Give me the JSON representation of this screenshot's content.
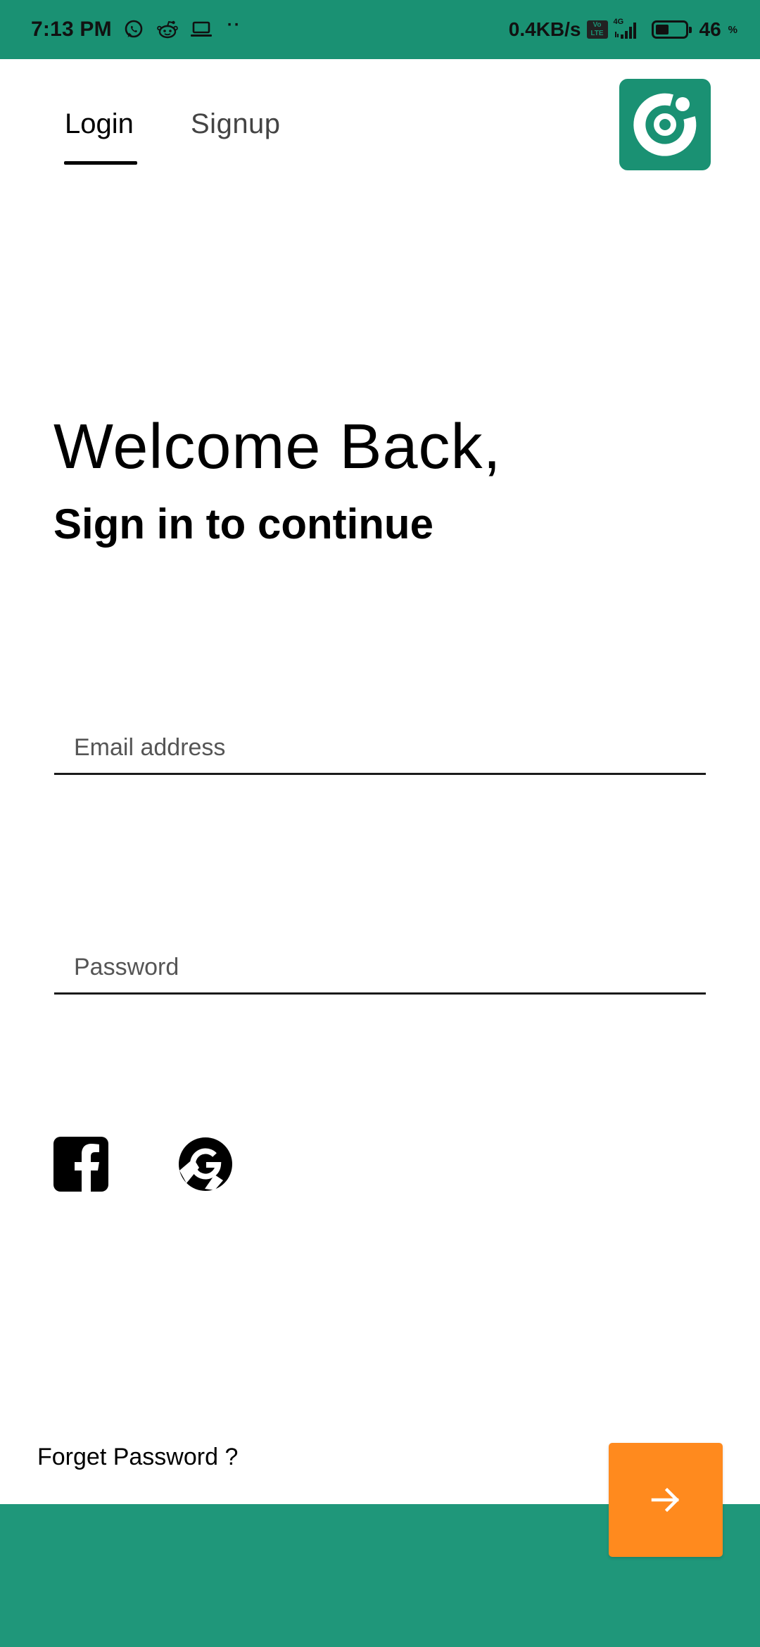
{
  "status_bar": {
    "time": "7:13 PM",
    "net_speed": "0.4KB/s",
    "volte_label": "Vo LTE",
    "network_type": "4G",
    "battery_level": "46",
    "battery_percent_sign": "%",
    "battery_fraction": 0.46,
    "overflow_dots": "··",
    "icons": [
      "whatsapp-icon",
      "reddit-icon",
      "laptop-icon",
      "volte-icon",
      "signal-icon",
      "battery-icon"
    ],
    "background_color": "#1a9173"
  },
  "tabs": [
    {
      "label": "Login",
      "active": true
    },
    {
      "label": "Signup",
      "active": false
    }
  ],
  "logo": {
    "icon": "app-logo-icon",
    "background_color": "#1a9173"
  },
  "heading": {
    "welcome": "Welcome Back,",
    "subtitle": "Sign in to continue"
  },
  "form": {
    "email": {
      "placeholder": "Email address",
      "value": ""
    },
    "password": {
      "placeholder": "Password",
      "value": ""
    }
  },
  "social": [
    {
      "icon": "facebook-icon"
    },
    {
      "icon": "google-icon"
    }
  ],
  "footer": {
    "forget_password": "Forget Password ?",
    "next_icon": "arrow-right-icon",
    "next_button_color": "#ff8a1e",
    "band_color": "#1f977a"
  }
}
